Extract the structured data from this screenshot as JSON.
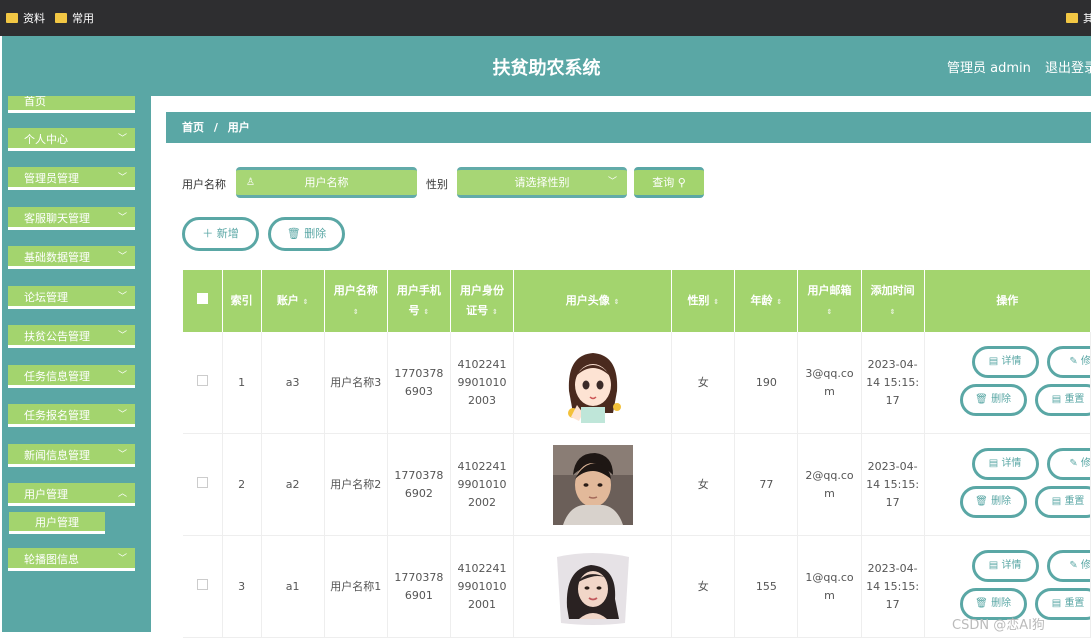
{
  "bookmarks": [
    "资料",
    "常用",
    "其"
  ],
  "header": {
    "title": "扶贫助农系统",
    "admin": "管理员 admin",
    "logout": "退出登录"
  },
  "sidebar": {
    "items": [
      {
        "label": "首页"
      },
      {
        "label": "个人中心"
      },
      {
        "label": "管理员管理"
      },
      {
        "label": "客服聊天管理"
      },
      {
        "label": "基础数据管理"
      },
      {
        "label": "论坛管理"
      },
      {
        "label": "扶贫公告管理"
      },
      {
        "label": "任务信息管理"
      },
      {
        "label": "任务报名管理"
      },
      {
        "label": "新闻信息管理"
      },
      {
        "label": "用户管理"
      },
      {
        "label": "轮播图信息"
      }
    ],
    "sub": "用户管理"
  },
  "breadcrumb": {
    "home": "首页",
    "sep": "/",
    "current": "用户"
  },
  "search": {
    "name_label": "用户名称",
    "name_placeholder": "用户名称",
    "gender_label": "性别",
    "gender_placeholder": "请选择性别",
    "query": "查询"
  },
  "actions": {
    "add": "新增",
    "delete": "删除"
  },
  "table": {
    "headers": [
      "索引",
      "账户",
      "用户名称",
      "用户手机号",
      "用户身份证号",
      "用户头像",
      "性别",
      "年龄",
      "用户邮箱",
      "添加时间",
      "操作"
    ],
    "rows": [
      {
        "index": "1",
        "account": "a3",
        "name": "用户名称3",
        "phone": "17703786903",
        "idcard": "410224199010102003",
        "gender": "女",
        "age": "190",
        "email": "3@qq.com",
        "time": "2023-04-14 15:15:17"
      },
      {
        "index": "2",
        "account": "a2",
        "name": "用户名称2",
        "phone": "17703786902",
        "idcard": "410224199010102002",
        "gender": "女",
        "age": "77",
        "email": "2@qq.com",
        "time": "2023-04-14 15:15:17"
      },
      {
        "index": "3",
        "account": "a1",
        "name": "用户名称1",
        "phone": "17703786901",
        "idcard": "410224199010102001",
        "gender": "女",
        "age": "155",
        "email": "1@qq.com",
        "time": "2023-04-14 15:15:17"
      }
    ],
    "row_buttons": {
      "detail": "详情",
      "edit": "修",
      "delete": "删除",
      "reset": "重置"
    }
  },
  "watermark": "CSDN @恋AI狗",
  "colors": {
    "teal": "#5aa7a5",
    "green": "#a3d46e"
  }
}
